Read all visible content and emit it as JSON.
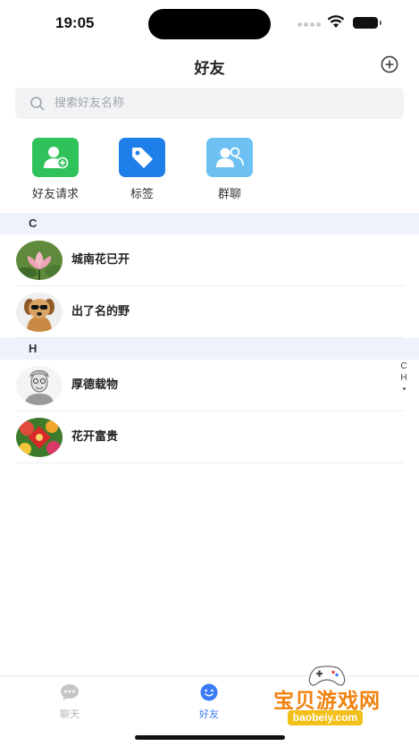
{
  "status_bar": {
    "time": "19:05"
  },
  "header": {
    "title": "好友"
  },
  "search": {
    "placeholder": "搜索好友名称"
  },
  "quick_actions": [
    {
      "label": "好友请求",
      "icon": "add-user-icon",
      "color": "#2fc25b"
    },
    {
      "label": "标签",
      "icon": "tag-icon",
      "color": "#1f7fe8"
    },
    {
      "label": "群聊",
      "icon": "group-icon",
      "color": "#6cc0f2"
    }
  ],
  "sections": [
    {
      "letter": "C",
      "contacts": [
        {
          "name": "城南花已开",
          "avatar": "lotus-photo"
        },
        {
          "name": "出了名的野",
          "avatar": "dog-photo"
        }
      ]
    },
    {
      "letter": "H",
      "contacts": [
        {
          "name": "厚德载物",
          "avatar": "sketch-portrait"
        },
        {
          "name": "花开富贵",
          "avatar": "flowers-fu-photo"
        }
      ]
    }
  ],
  "index_bar": {
    "letters": [
      "C",
      "H"
    ]
  },
  "tabbar": {
    "tabs": [
      {
        "label": "聊天",
        "active": false
      },
      {
        "label": "好友",
        "active": true
      }
    ]
  },
  "watermark": {
    "text": "宝贝游戏网",
    "url": "baobeiy.com"
  },
  "colors": {
    "accent": "#3b7cf6",
    "section_bg": "#eef3fb",
    "search_bg": "#f2f3f5"
  }
}
